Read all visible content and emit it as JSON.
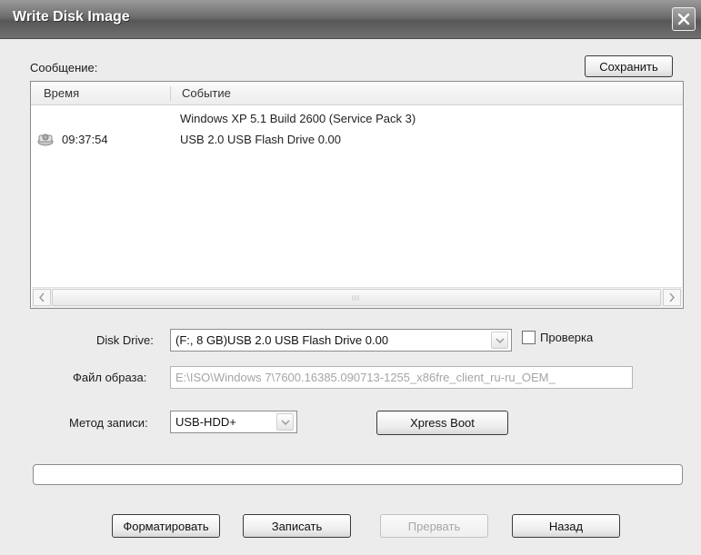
{
  "window": {
    "title": "Write Disk Image"
  },
  "message": {
    "label": "Сообщение:",
    "save_button": "Сохранить"
  },
  "log": {
    "columns": [
      "Время",
      "Событие"
    ],
    "rows": [
      {
        "time": "",
        "event": "Windows XP 5.1 Build 2600 (Service Pack 3)"
      },
      {
        "time": "09:37:54",
        "event": "USB 2.0 USB Flash Drive 0.00",
        "icon": "drive-icon"
      }
    ]
  },
  "disk_drive": {
    "label": "Disk Drive:",
    "value": "(F:, 8 GB)USB 2.0 USB Flash Drive 0.00",
    "verify_label": "Проверка",
    "verify_checked": false
  },
  "image_file": {
    "label": "Файл образа:",
    "value": "E:\\ISO\\Windows 7\\7600.16385.090713-1255_x86fre_client_ru-ru_OEM_"
  },
  "write_method": {
    "label": "Метод записи:",
    "value": "USB-HDD+",
    "xpress_boot_button": "Xpress Boot"
  },
  "progress": {
    "value": 0
  },
  "buttons": {
    "format": "Форматировать",
    "write": "Записать",
    "abort": "Прервать",
    "back": "Назад"
  },
  "colors": {
    "window_bg": "#ececec",
    "titlebar": "#6c6c6c"
  }
}
